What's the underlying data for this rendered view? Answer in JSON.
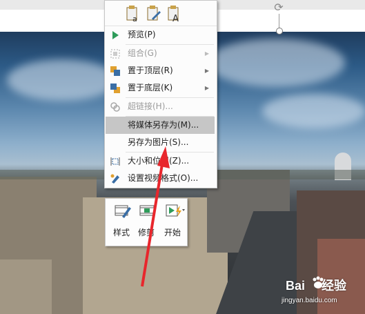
{
  "menu": {
    "paste_options": [
      {
        "icon": "paste-keep-formatting-icon"
      },
      {
        "icon": "paste-picture-icon"
      },
      {
        "icon": "paste-text-only-icon"
      }
    ],
    "items": [
      {
        "label": "预览(P)",
        "icon": "play-icon",
        "enabled": true,
        "submenu": false
      },
      {
        "label": "组合(G)",
        "icon": "group-icon",
        "enabled": false,
        "submenu": true
      },
      {
        "label": "置于顶层(R)",
        "icon": "bring-to-front-icon",
        "enabled": true,
        "submenu": true
      },
      {
        "label": "置于底层(K)",
        "icon": "send-to-back-icon",
        "enabled": true,
        "submenu": true
      },
      {
        "label": "超链接(H)...",
        "icon": "hyperlink-icon",
        "enabled": false,
        "submenu": false
      },
      {
        "label": "将媒体另存为(M)...",
        "icon": "",
        "enabled": true,
        "submenu": false,
        "highlighted": true
      },
      {
        "label": "另存为图片(S)...",
        "icon": "",
        "enabled": true,
        "submenu": false
      },
      {
        "label": "大小和位置(Z)...",
        "icon": "size-position-icon",
        "enabled": true,
        "submenu": false
      },
      {
        "label": "设置视频格式(O)...",
        "icon": "format-video-icon",
        "enabled": true,
        "submenu": false
      }
    ]
  },
  "mini_toolbar": {
    "buttons": [
      {
        "label": "样式",
        "icon": "video-style-icon"
      },
      {
        "label": "修剪",
        "icon": "trim-video-icon"
      },
      {
        "label": "开始",
        "icon": "start-play-icon"
      }
    ]
  },
  "watermark": {
    "brand_left": "Bai",
    "brand_right": "经验",
    "url": "jingyan.baidu.com"
  },
  "colors": {
    "menu_highlight": "#c6c6c6",
    "annotation_arrow": "#e8262c",
    "play_icon": "#2e9c5a"
  }
}
